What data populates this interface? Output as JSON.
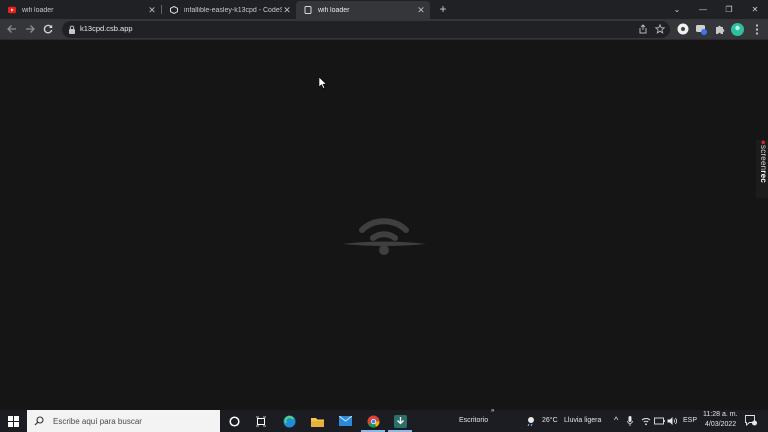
{
  "browser": {
    "tabs": [
      {
        "title": "wifi loader",
        "favicon": "youtube-icon",
        "active": false
      },
      {
        "title": "infallible-easley-k13cpd - CodeS",
        "favicon": "codesandbox-icon",
        "active": false
      },
      {
        "title": "wifi loader",
        "favicon": "page-icon",
        "active": true
      }
    ],
    "new_tab_label": "+",
    "address": "k13cpd.csb.app"
  },
  "page": {
    "loader": "wifi-loader-icon"
  },
  "overlay": {
    "screenrec_prefix": "screen",
    "screenrec_brand": "rec"
  },
  "taskbar": {
    "search_placeholder": "Escribe aquí para buscar",
    "desktop_label": "Escritorio",
    "weather_temp": "26°C",
    "weather_desc": "Lluvia ligera",
    "language": "ESP",
    "time": "11:28 a. m.",
    "date": "4/03/2022"
  },
  "colors": {
    "page_background": "#151515",
    "loader_gray": "#3f3f3f"
  }
}
